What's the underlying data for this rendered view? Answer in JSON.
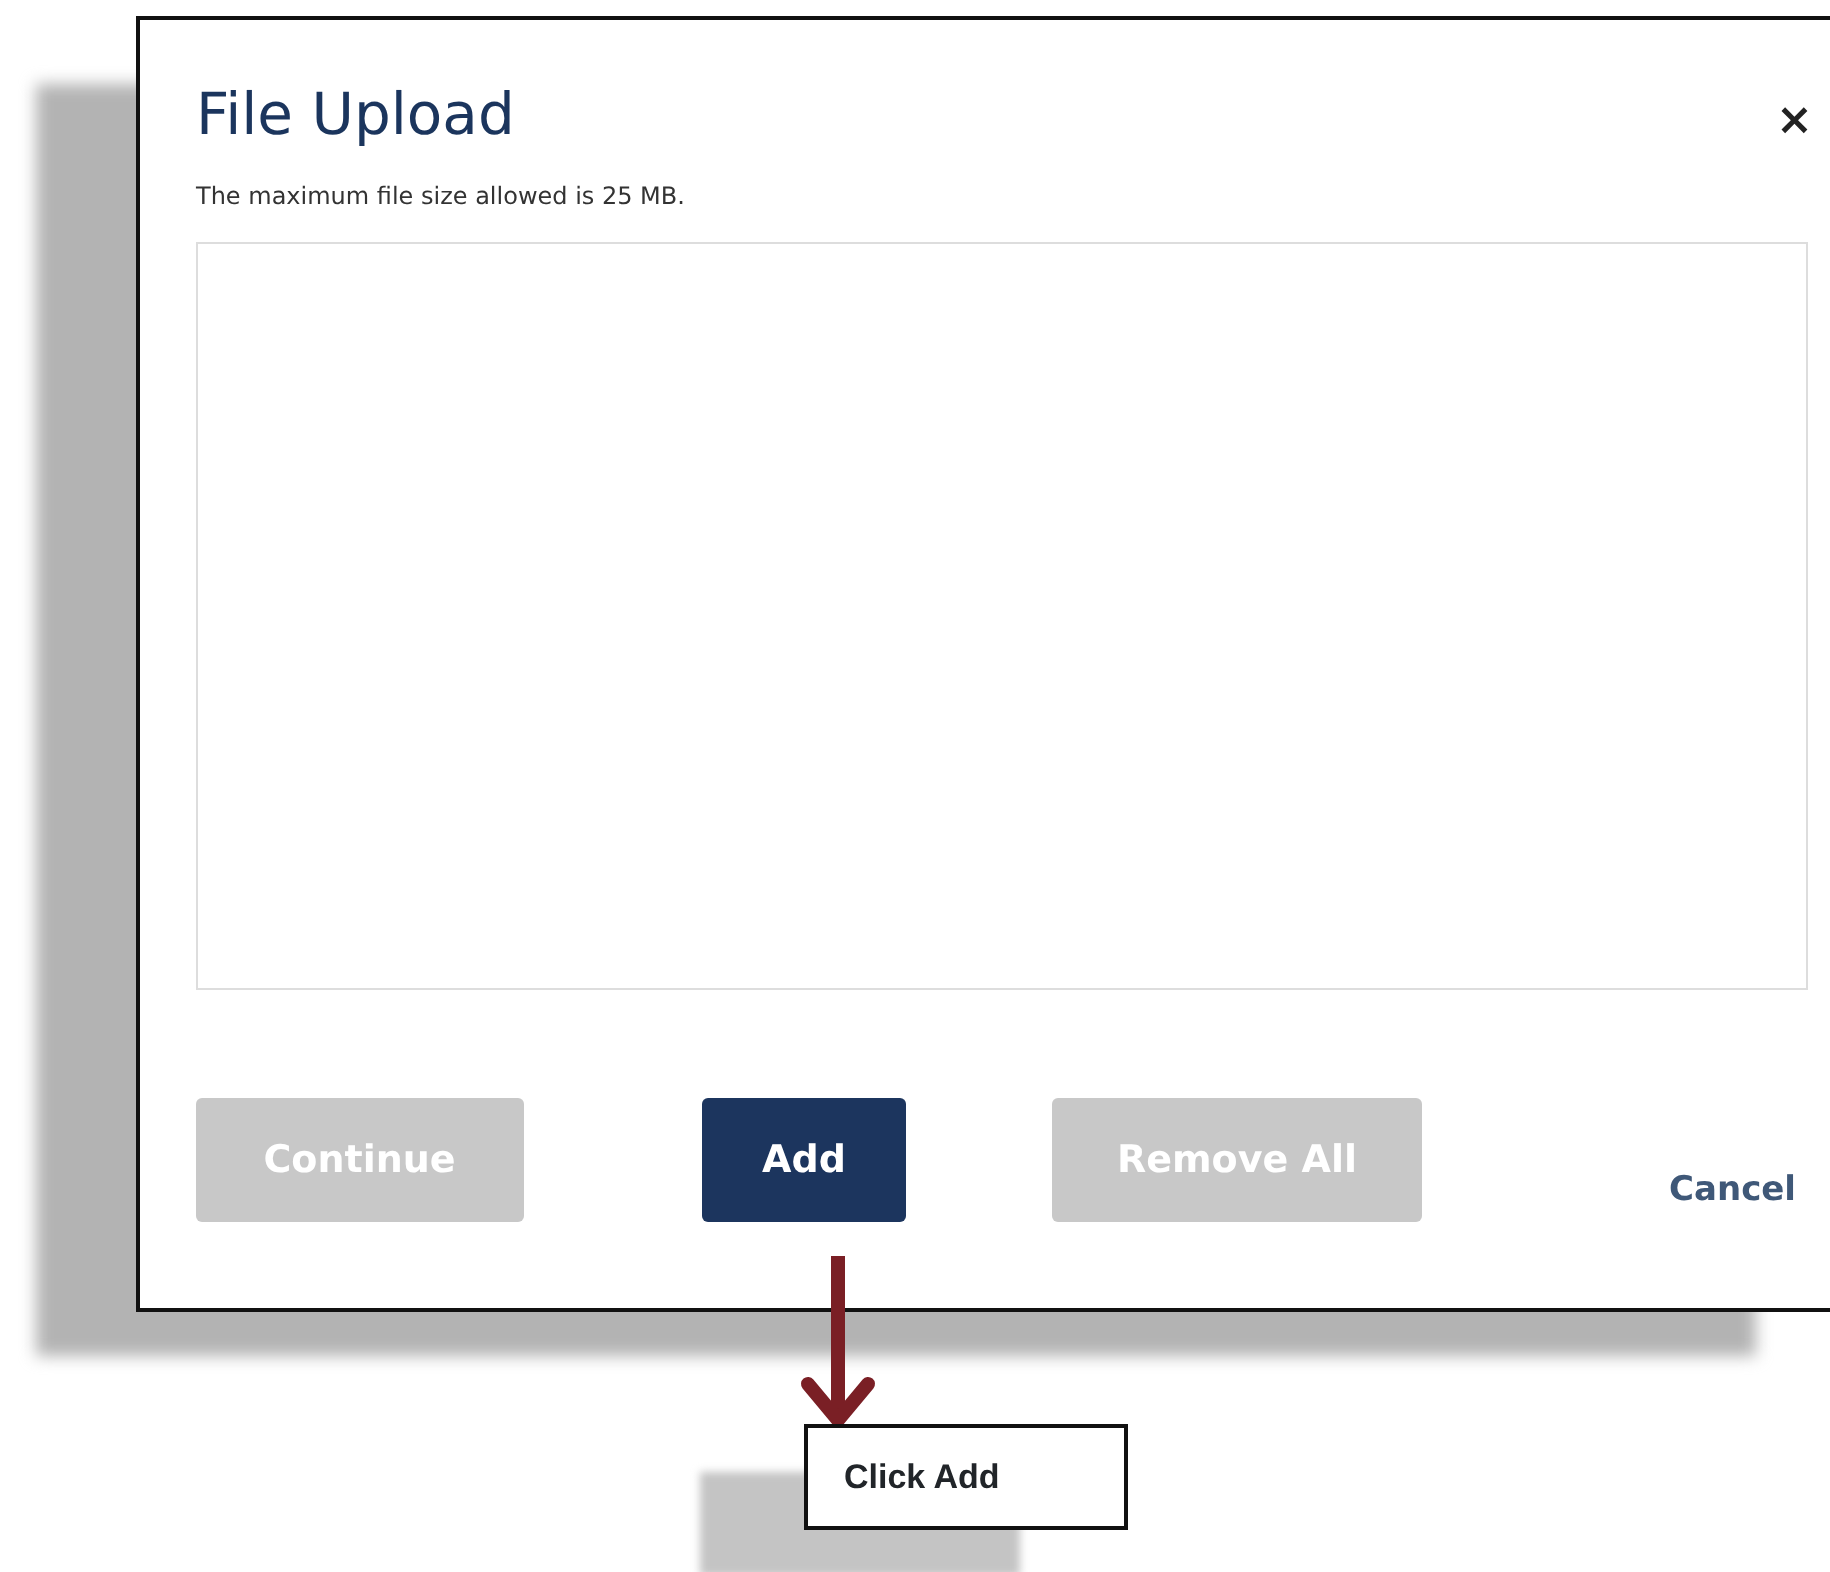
{
  "dialog": {
    "title": "File Upload",
    "close": "×",
    "note": "The maximum file size allowed is 25 MB."
  },
  "buttons": [
    {
      "label": "Continue",
      "kind": "button",
      "disabled": true
    },
    {
      "label": "Add",
      "kind": "button",
      "disabled": false
    },
    {
      "label": "Remove All",
      "kind": "button",
      "disabled": true
    },
    {
      "label": "Cancel",
      "kind": "link",
      "disabled": false
    }
  ],
  "callout": {
    "text": "Click Add"
  }
}
